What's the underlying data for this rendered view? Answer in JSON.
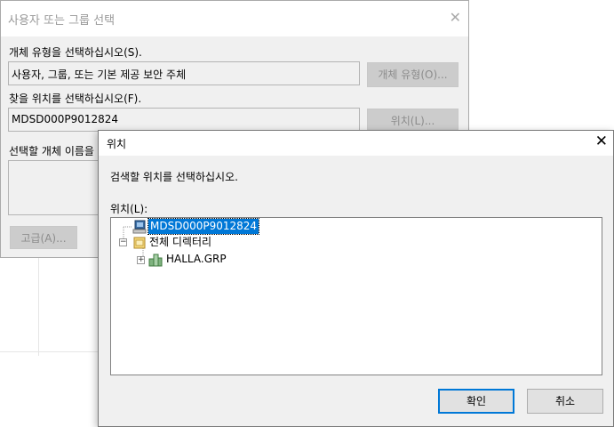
{
  "back_dialog": {
    "title": "사용자 또는 그룹 선택",
    "object_type_label": "개체 유형을 선택하십시오(S).",
    "object_type_value": "사용자, 그룹, 또는 기본 제공 보안 주체",
    "object_type_button": "개체 유형(O)...",
    "location_label": "찾을 위치를 선택하십시오(F).",
    "location_value": "MDSD000P9012824",
    "location_button": "위치(L)...",
    "names_label": "선택할 개체 이름을",
    "advanced_button": "고급(A)..."
  },
  "location_dialog": {
    "title": "위치",
    "instruction": "검색할 위치를 선택하십시오.",
    "tree_label": "위치(L):",
    "tree": [
      {
        "label": "MDSD000P9012824",
        "selected": true,
        "icon": "computer-icon"
      },
      {
        "label": "전체 디렉터리",
        "selected": false,
        "icon": "directory-icon"
      },
      {
        "label": "HALLA.GRP",
        "selected": false,
        "icon": "domain-icon"
      }
    ],
    "ok_button": "확인",
    "cancel_button": "취소"
  },
  "colors": {
    "selection": "#0078d7",
    "dialog_bg": "#f0f0f0"
  }
}
